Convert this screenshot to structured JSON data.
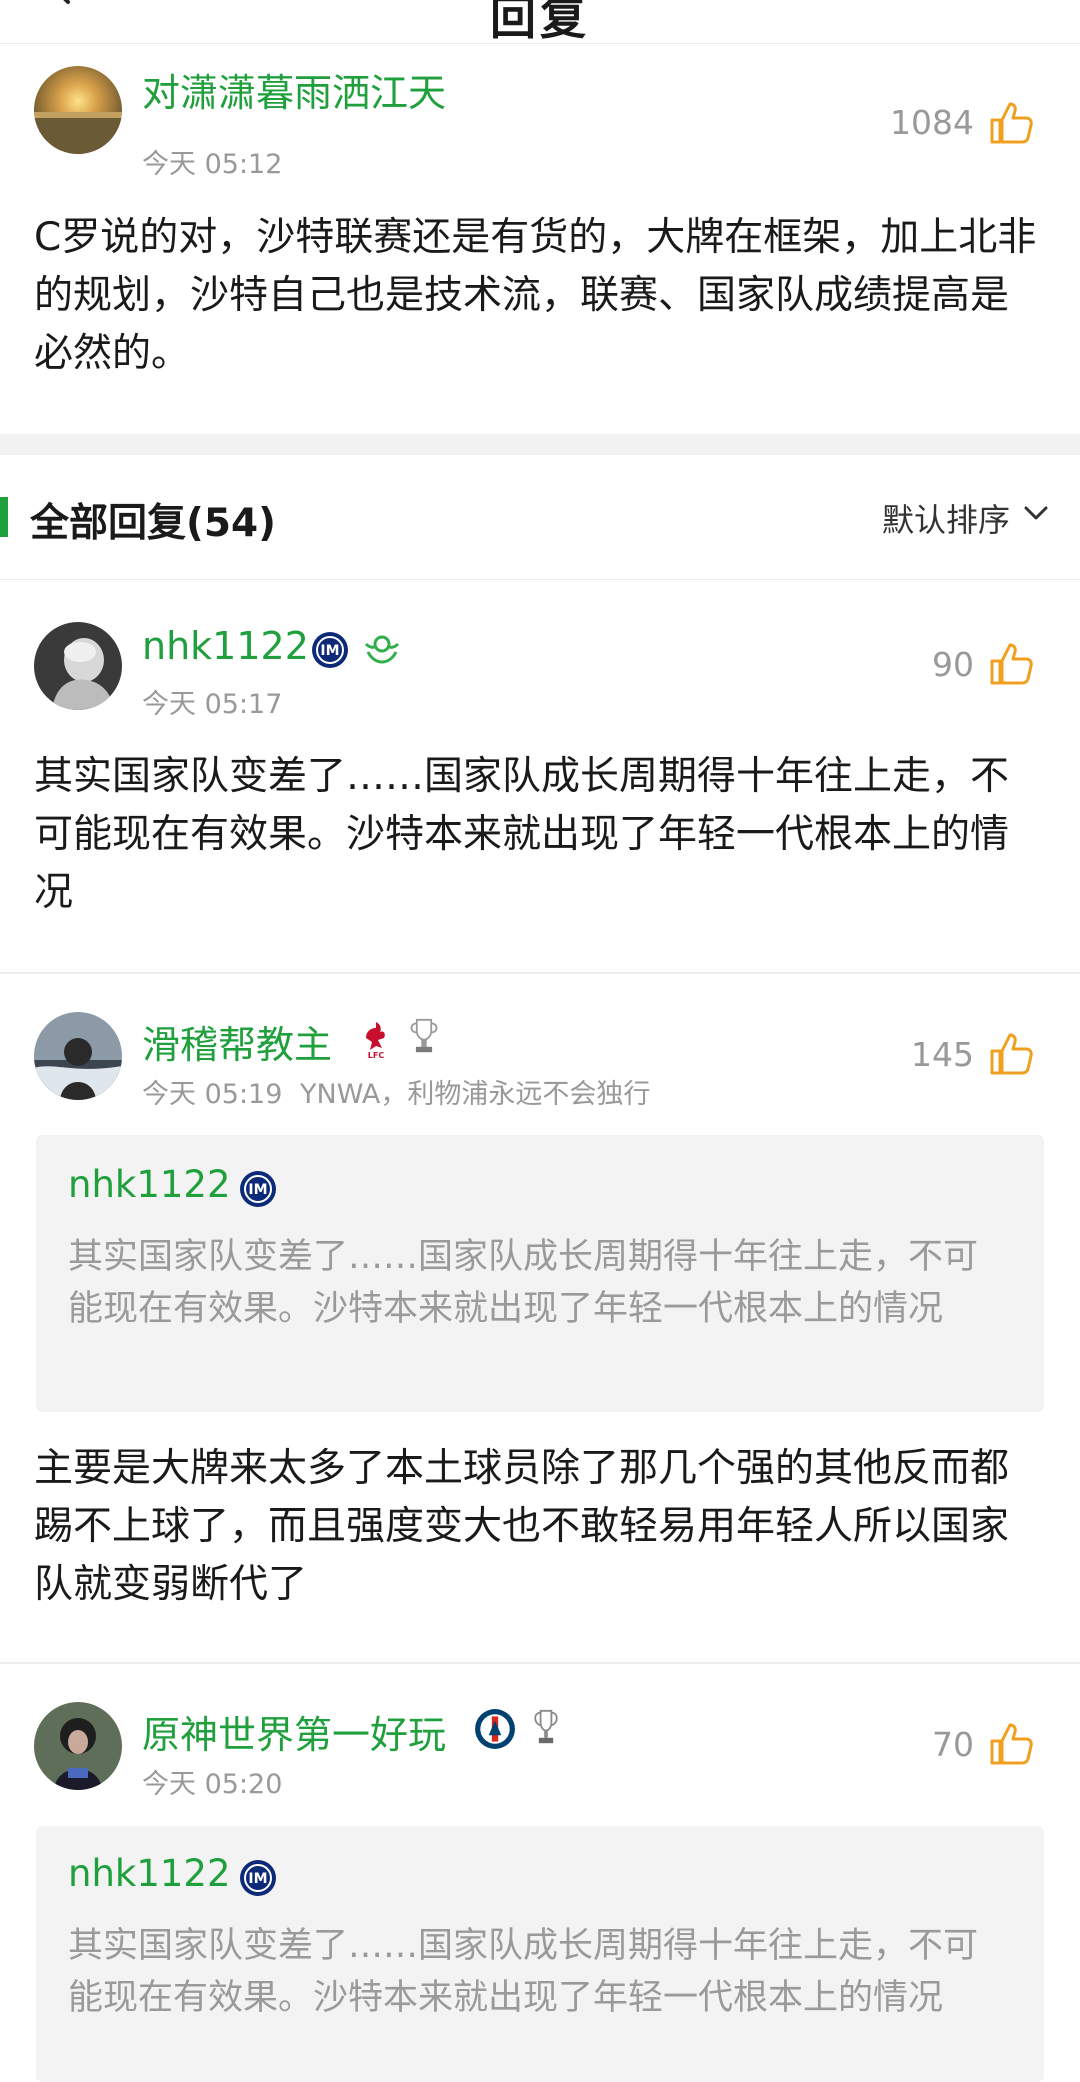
{
  "header": {
    "title": "回复"
  },
  "post": {
    "username": "对潇潇暮雨洒江天",
    "time": "今天 05:12",
    "likes": "1084",
    "body": "C罗说的对，沙特联赛还是有货的，大牌在框架，加上北非的规划，沙特自己也是技术流，联赛、国家队成绩提高是必然的。"
  },
  "replies_header": {
    "label": "全部回复(54)",
    "sort_label": "默认排序"
  },
  "replies": [
    {
      "username": "nhk1122",
      "time": "今天 05:17",
      "likes": "90",
      "body": "其实国家队变差了……国家队成长周期得十年往上走，不可能现在有效果。沙特本来就出现了年轻一代根本上的情况"
    },
    {
      "username": "滑稽帮教主",
      "time": "今天 05:19",
      "signature": "YNWA，利物浦永远不会独行",
      "likes": "145",
      "quote_user": "nhk1122",
      "quote_text": "其实国家队变差了……国家队成长周期得十年往上走，不可能现在有效果。沙特本来就出现了年轻一代根本上的情况",
      "body": "主要是大牌来太多了本土球员除了那几个强的其他反而都踢不上球了，而且强度变大也不敢轻易用年轻人所以国家队就变弱断代了"
    },
    {
      "username": "原神世界第一好玩",
      "time": "今天 05:20",
      "likes": "70",
      "quote_user": "nhk1122",
      "quote_text": "其实国家队变差了……国家队成长周期得十年往上走，不可能现在有效果。沙特本来就出现了年轻一代根本上的情况"
    }
  ],
  "colors": {
    "accent": "#1fa03c",
    "like_icon": "#f0a020",
    "muted": "#999999"
  },
  "icons": [
    "back-arrow-icon",
    "thumbs-up-icon",
    "chevron-down-icon",
    "inter-milan-badge-icon",
    "green-leaf-badge-icon",
    "liverpool-badge-icon",
    "trophy-icon",
    "psg-badge-icon"
  ]
}
